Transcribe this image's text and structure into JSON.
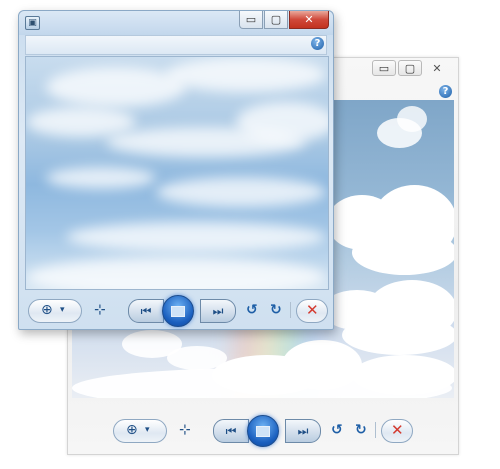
{
  "window": {
    "minimize_glyph": "▭",
    "maximize_glyph": "▢",
    "close_glyph": "✕",
    "help_glyph": "?"
  },
  "controls": {
    "zoom_glyph": "⊕",
    "dropdown_glyph": "▾",
    "actual_size_glyph": "⊹",
    "previous_glyph": "⏮",
    "next_glyph": "⏭",
    "rotate_ccw_glyph": "↺",
    "rotate_cw_glyph": "↻",
    "delete_glyph": "✕"
  },
  "icons": {
    "app": "photo-viewer-icon",
    "zoom": "zoom-icon",
    "actual_size": "actual-size-icon",
    "previous": "previous-icon",
    "slideshow": "slideshow-icon",
    "next": "next-icon",
    "rotate_ccw": "rotate-counterclockwise-icon",
    "rotate_cw": "rotate-clockwise-icon",
    "delete": "delete-icon",
    "help": "help-icon"
  },
  "colors": {
    "accent_blue": "#1a5fbf",
    "close_red": "#d0493a",
    "delete_red": "#d43a2f",
    "sky_blue": "#8eb8df"
  }
}
